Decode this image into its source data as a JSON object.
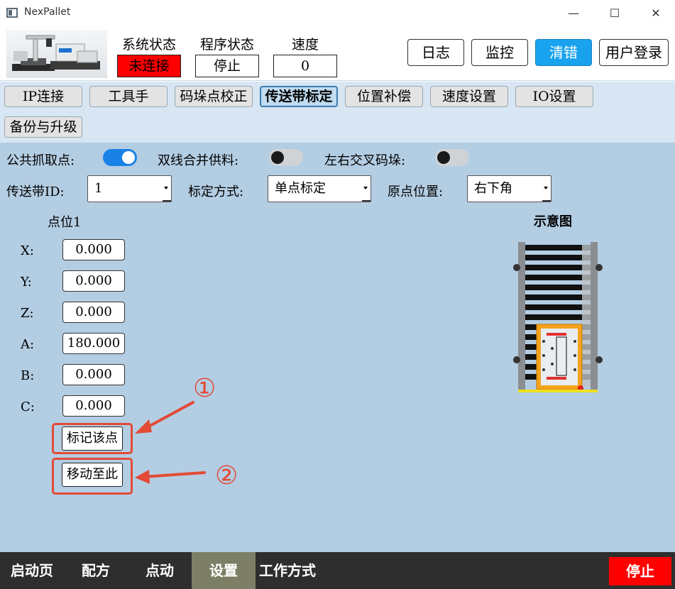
{
  "window": {
    "title": "NexPallet"
  },
  "header": {
    "system_status": {
      "label": "系统状态",
      "value": "未连接",
      "color": "#ff0000"
    },
    "program_status": {
      "label": "程序状态",
      "value": "停止"
    },
    "speed": {
      "label": "速度",
      "value": "0"
    },
    "buttons": {
      "log": "日志",
      "monitor": "监控",
      "clear_error": "清错",
      "user_login": "用户登录"
    }
  },
  "tabs": [
    "IP连接",
    "工具手",
    "码垛点校正",
    "传送带标定",
    "位置补偿",
    "速度设置",
    "IO设置",
    "备份与升级"
  ],
  "active_tab": "传送带标定",
  "toggles": {
    "common_pick": {
      "label": "公共抓取点:",
      "on": true
    },
    "dual_line_merge": {
      "label": "双线合并供料:",
      "on": false
    },
    "left_right_cross": {
      "label": "左右交叉码垛:",
      "on": false
    }
  },
  "selects": {
    "conveyor_id": {
      "label": "传送带ID:",
      "value": "1"
    },
    "calib_method": {
      "label": "标定方式:",
      "value": "单点标定"
    },
    "origin_pos": {
      "label": "原点位置:",
      "value": "右下角"
    }
  },
  "point": {
    "title": "点位1",
    "coords": [
      {
        "label": "X:",
        "value": "0.000"
      },
      {
        "label": "Y:",
        "value": "0.000"
      },
      {
        "label": "Z:",
        "value": "0.000"
      },
      {
        "label": "A:",
        "value": "180.000"
      },
      {
        "label": "B:",
        "value": "0.000"
      },
      {
        "label": "C:",
        "value": "0.000"
      }
    ],
    "mark_button": "标记该点",
    "move_button": "移动至此"
  },
  "annotations": {
    "one": "①",
    "two": "②",
    "color": "#e34a35"
  },
  "diagram": {
    "title": "示意图"
  },
  "bottom_nav": {
    "items": [
      "启动页",
      "配方",
      "点动",
      "设置",
      "工作方式"
    ],
    "active": "设置",
    "stop": "停止"
  }
}
